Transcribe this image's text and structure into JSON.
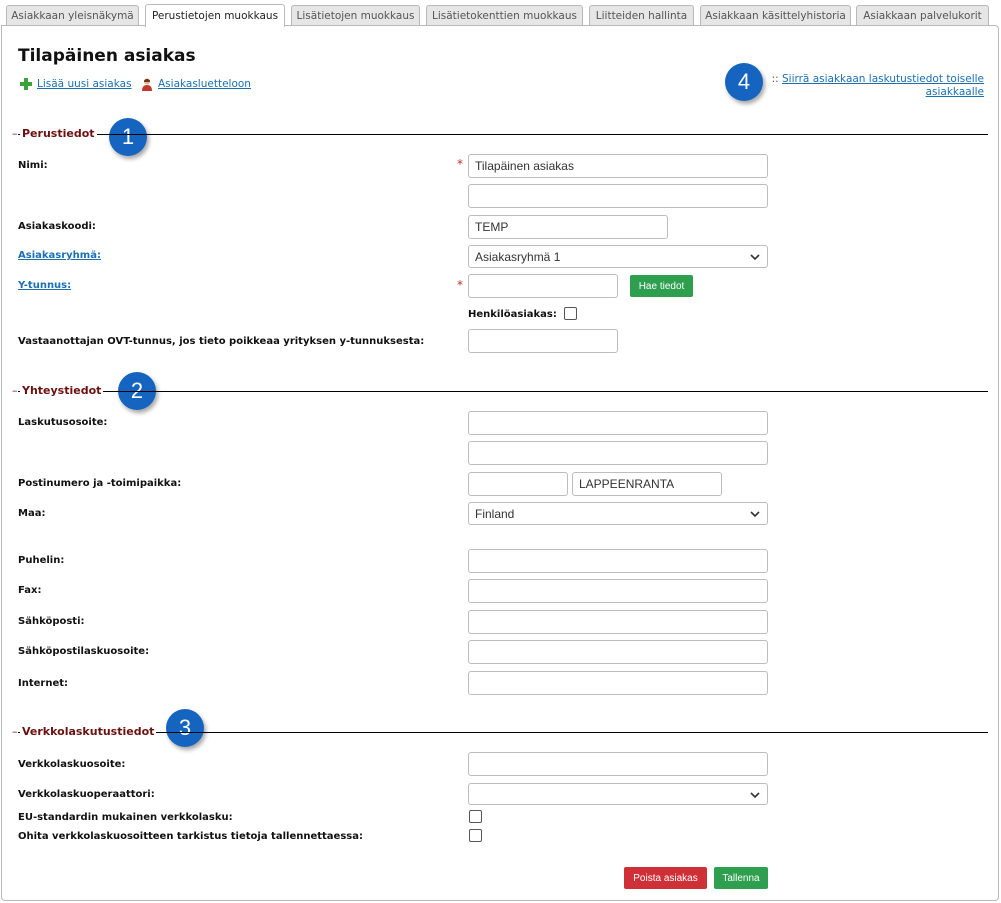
{
  "tabs": [
    {
      "label": "Asiakkaan yleisnäkymä"
    },
    {
      "label": "Perustietojen muokkaus"
    },
    {
      "label": "Lisätietojen muokkaus"
    },
    {
      "label": "Lisätietokenttien muokkaus"
    },
    {
      "label": "Liitteiden hallinta"
    },
    {
      "label": "Asiakkaan käsittelyhistoria"
    },
    {
      "label": "Asiakkaan palvelukorit"
    }
  ],
  "active_tab": "Perustietojen muokkaus",
  "page_title": "Tilapäinen asiakas",
  "links": {
    "add_customer": "Lisää uusi asiakas",
    "customer_list": "Asiakasluetteloon",
    "move_billing_sep": "::",
    "move_billing": "Siirrä asiakkaan laskutustiedot toiselle asiakkaalle"
  },
  "badges": [
    "1",
    "2",
    "3",
    "4"
  ],
  "sections": {
    "basic": "Perustiedot",
    "contact": "Yhteystiedot",
    "einvoice": "Verkkolaskutustiedot"
  },
  "basic": {
    "name_label": "Nimi:",
    "name_value": "Tilapäinen asiakas",
    "name2_value": "",
    "code_label": "Asiakaskoodi:",
    "code_value": "TEMP",
    "group_label": "Asiakasryhmä:",
    "group_value": "Asiakasryhmä 1",
    "ytunnus_label": "Y-tunnus:",
    "ytunnus_value": "",
    "fetch_button": "Hae tiedot",
    "person_label": "Henkilöasiakas:",
    "ovt_label": "Vastaanottajan OVT-tunnus, jos tieto poikkeaa yrityksen y-tunnuksesta:",
    "ovt_value": ""
  },
  "contact": {
    "address_label": "Laskutusosoite:",
    "address1": "",
    "address2": "",
    "postal_label": "Postinumero ja -toimipaikka:",
    "postal_code": "",
    "city": "LAPPEENRANTA",
    "country_label": "Maa:",
    "country_value": "Finland",
    "phone_label": "Puhelin:",
    "fax_label": "Fax:",
    "email_label": "Sähköposti:",
    "email_invoice_label": "Sähköpostilaskuosoite:",
    "internet_label": "Internet:"
  },
  "einvoice": {
    "address_label": "Verkkolaskuosoite:",
    "operator_label": "Verkkolaskuoperaattori:",
    "eu_label": "EU-standardin mukainen verkkolasku:",
    "skip_label": "Ohita verkkolaskuosoitteen tarkistus tietoja tallennettaessa:"
  },
  "actions": {
    "delete": "Poista asiakas",
    "save": "Tallenna"
  },
  "colors": {
    "badge": "#1565c0",
    "section_title": "#6b0f0f",
    "link": "#1a6fb5",
    "green_button": "#2e9e4f",
    "red_button": "#cf3038",
    "required": "#c0302a"
  }
}
